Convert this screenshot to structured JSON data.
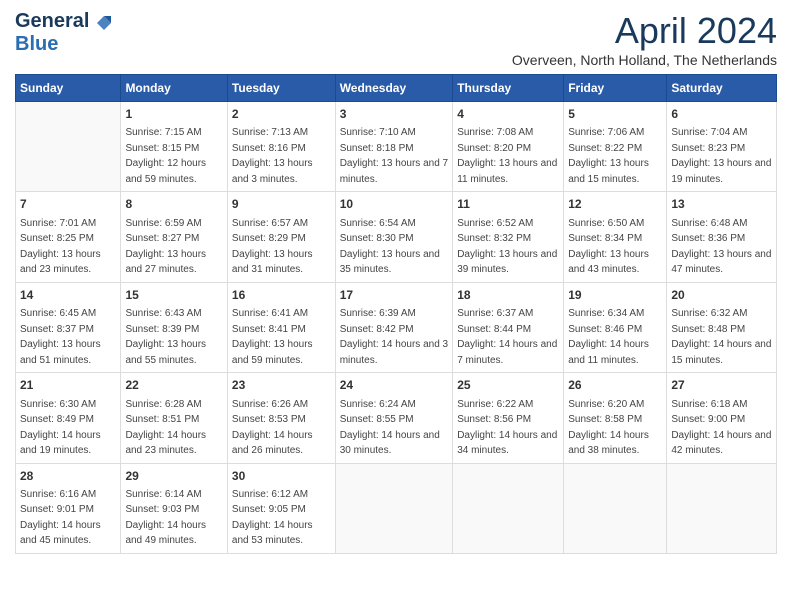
{
  "header": {
    "logo_line1": "General",
    "logo_line2": "Blue",
    "month_title": "April 2024",
    "location": "Overveen, North Holland, The Netherlands"
  },
  "days_of_week": [
    "Sunday",
    "Monday",
    "Tuesday",
    "Wednesday",
    "Thursday",
    "Friday",
    "Saturday"
  ],
  "weeks": [
    [
      {
        "day": "",
        "sunrise": "",
        "sunset": "",
        "daylight": ""
      },
      {
        "day": "1",
        "sunrise": "Sunrise: 7:15 AM",
        "sunset": "Sunset: 8:15 PM",
        "daylight": "Daylight: 12 hours and 59 minutes."
      },
      {
        "day": "2",
        "sunrise": "Sunrise: 7:13 AM",
        "sunset": "Sunset: 8:16 PM",
        "daylight": "Daylight: 13 hours and 3 minutes."
      },
      {
        "day": "3",
        "sunrise": "Sunrise: 7:10 AM",
        "sunset": "Sunset: 8:18 PM",
        "daylight": "Daylight: 13 hours and 7 minutes."
      },
      {
        "day": "4",
        "sunrise": "Sunrise: 7:08 AM",
        "sunset": "Sunset: 8:20 PM",
        "daylight": "Daylight: 13 hours and 11 minutes."
      },
      {
        "day": "5",
        "sunrise": "Sunrise: 7:06 AM",
        "sunset": "Sunset: 8:22 PM",
        "daylight": "Daylight: 13 hours and 15 minutes."
      },
      {
        "day": "6",
        "sunrise": "Sunrise: 7:04 AM",
        "sunset": "Sunset: 8:23 PM",
        "daylight": "Daylight: 13 hours and 19 minutes."
      }
    ],
    [
      {
        "day": "7",
        "sunrise": "Sunrise: 7:01 AM",
        "sunset": "Sunset: 8:25 PM",
        "daylight": "Daylight: 13 hours and 23 minutes."
      },
      {
        "day": "8",
        "sunrise": "Sunrise: 6:59 AM",
        "sunset": "Sunset: 8:27 PM",
        "daylight": "Daylight: 13 hours and 27 minutes."
      },
      {
        "day": "9",
        "sunrise": "Sunrise: 6:57 AM",
        "sunset": "Sunset: 8:29 PM",
        "daylight": "Daylight: 13 hours and 31 minutes."
      },
      {
        "day": "10",
        "sunrise": "Sunrise: 6:54 AM",
        "sunset": "Sunset: 8:30 PM",
        "daylight": "Daylight: 13 hours and 35 minutes."
      },
      {
        "day": "11",
        "sunrise": "Sunrise: 6:52 AM",
        "sunset": "Sunset: 8:32 PM",
        "daylight": "Daylight: 13 hours and 39 minutes."
      },
      {
        "day": "12",
        "sunrise": "Sunrise: 6:50 AM",
        "sunset": "Sunset: 8:34 PM",
        "daylight": "Daylight: 13 hours and 43 minutes."
      },
      {
        "day": "13",
        "sunrise": "Sunrise: 6:48 AM",
        "sunset": "Sunset: 8:36 PM",
        "daylight": "Daylight: 13 hours and 47 minutes."
      }
    ],
    [
      {
        "day": "14",
        "sunrise": "Sunrise: 6:45 AM",
        "sunset": "Sunset: 8:37 PM",
        "daylight": "Daylight: 13 hours and 51 minutes."
      },
      {
        "day": "15",
        "sunrise": "Sunrise: 6:43 AM",
        "sunset": "Sunset: 8:39 PM",
        "daylight": "Daylight: 13 hours and 55 minutes."
      },
      {
        "day": "16",
        "sunrise": "Sunrise: 6:41 AM",
        "sunset": "Sunset: 8:41 PM",
        "daylight": "Daylight: 13 hours and 59 minutes."
      },
      {
        "day": "17",
        "sunrise": "Sunrise: 6:39 AM",
        "sunset": "Sunset: 8:42 PM",
        "daylight": "Daylight: 14 hours and 3 minutes."
      },
      {
        "day": "18",
        "sunrise": "Sunrise: 6:37 AM",
        "sunset": "Sunset: 8:44 PM",
        "daylight": "Daylight: 14 hours and 7 minutes."
      },
      {
        "day": "19",
        "sunrise": "Sunrise: 6:34 AM",
        "sunset": "Sunset: 8:46 PM",
        "daylight": "Daylight: 14 hours and 11 minutes."
      },
      {
        "day": "20",
        "sunrise": "Sunrise: 6:32 AM",
        "sunset": "Sunset: 8:48 PM",
        "daylight": "Daylight: 14 hours and 15 minutes."
      }
    ],
    [
      {
        "day": "21",
        "sunrise": "Sunrise: 6:30 AM",
        "sunset": "Sunset: 8:49 PM",
        "daylight": "Daylight: 14 hours and 19 minutes."
      },
      {
        "day": "22",
        "sunrise": "Sunrise: 6:28 AM",
        "sunset": "Sunset: 8:51 PM",
        "daylight": "Daylight: 14 hours and 23 minutes."
      },
      {
        "day": "23",
        "sunrise": "Sunrise: 6:26 AM",
        "sunset": "Sunset: 8:53 PM",
        "daylight": "Daylight: 14 hours and 26 minutes."
      },
      {
        "day": "24",
        "sunrise": "Sunrise: 6:24 AM",
        "sunset": "Sunset: 8:55 PM",
        "daylight": "Daylight: 14 hours and 30 minutes."
      },
      {
        "day": "25",
        "sunrise": "Sunrise: 6:22 AM",
        "sunset": "Sunset: 8:56 PM",
        "daylight": "Daylight: 14 hours and 34 minutes."
      },
      {
        "day": "26",
        "sunrise": "Sunrise: 6:20 AM",
        "sunset": "Sunset: 8:58 PM",
        "daylight": "Daylight: 14 hours and 38 minutes."
      },
      {
        "day": "27",
        "sunrise": "Sunrise: 6:18 AM",
        "sunset": "Sunset: 9:00 PM",
        "daylight": "Daylight: 14 hours and 42 minutes."
      }
    ],
    [
      {
        "day": "28",
        "sunrise": "Sunrise: 6:16 AM",
        "sunset": "Sunset: 9:01 PM",
        "daylight": "Daylight: 14 hours and 45 minutes."
      },
      {
        "day": "29",
        "sunrise": "Sunrise: 6:14 AM",
        "sunset": "Sunset: 9:03 PM",
        "daylight": "Daylight: 14 hours and 49 minutes."
      },
      {
        "day": "30",
        "sunrise": "Sunrise: 6:12 AM",
        "sunset": "Sunset: 9:05 PM",
        "daylight": "Daylight: 14 hours and 53 minutes."
      },
      {
        "day": "",
        "sunrise": "",
        "sunset": "",
        "daylight": ""
      },
      {
        "day": "",
        "sunrise": "",
        "sunset": "",
        "daylight": ""
      },
      {
        "day": "",
        "sunrise": "",
        "sunset": "",
        "daylight": ""
      },
      {
        "day": "",
        "sunrise": "",
        "sunset": "",
        "daylight": ""
      }
    ]
  ]
}
